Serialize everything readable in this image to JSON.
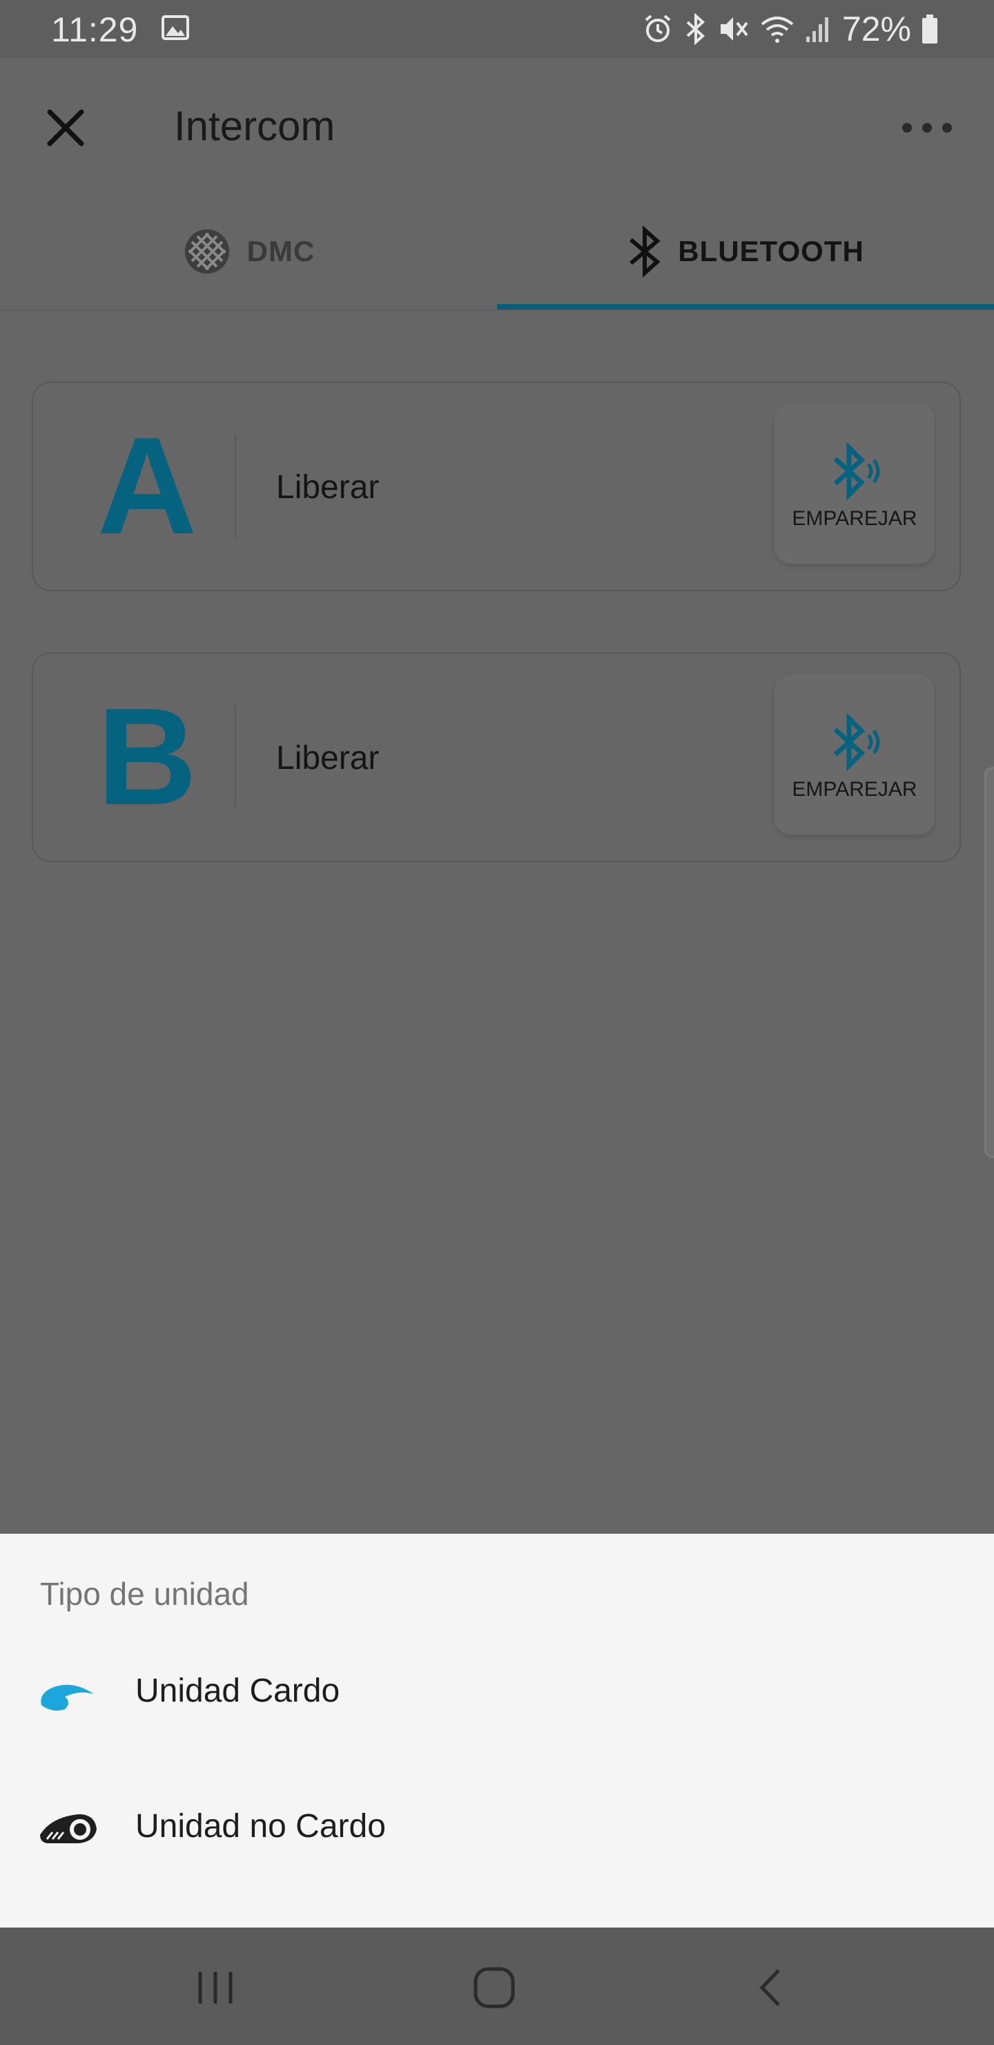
{
  "status_bar": {
    "time": "11:29",
    "battery": "72%",
    "icons": [
      "image-icon",
      "alarm-icon",
      "bluetooth-icon",
      "mute-icon",
      "wifi-icon",
      "signal-icon",
      "battery-icon"
    ]
  },
  "header": {
    "title": "Intercom"
  },
  "tabs": [
    {
      "label": "DMC",
      "icon": "dmc-mesh-icon",
      "selected": false
    },
    {
      "label": "BLUETOOTH",
      "icon": "bluetooth-icon",
      "selected": true
    }
  ],
  "slots": [
    {
      "letter": "A",
      "status": "Liberar",
      "pair_label": "EMPAREJAR"
    },
    {
      "letter": "B",
      "status": "Liberar",
      "pair_label": "EMPAREJAR"
    }
  ],
  "bottom_sheet": {
    "title": "Tipo de unidad",
    "options": [
      {
        "label": "Unidad Cardo",
        "icon": "cardo-unit-icon"
      },
      {
        "label": "Unidad no Cardo",
        "icon": "non-cardo-unit-icon"
      }
    ]
  },
  "colors": {
    "accent": "#06637f",
    "scrim": "#666666",
    "sheet_background": "#f5f5f5",
    "cardo_blue": "#1ba7d9"
  }
}
